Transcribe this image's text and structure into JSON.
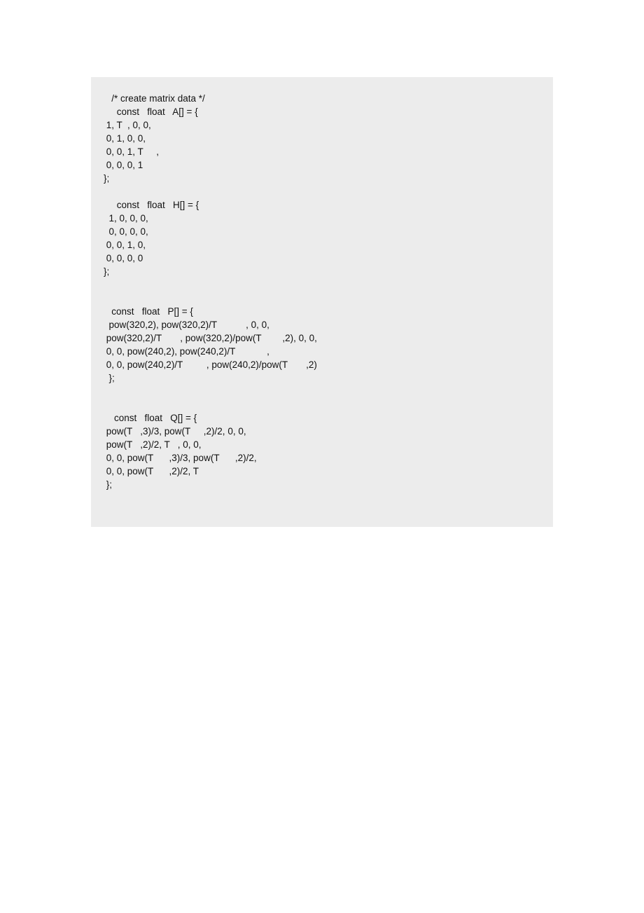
{
  "code": {
    "lines": [
      "   /* create matrix data */",
      "     const   float   A[] = {",
      " 1, T  , 0, 0,",
      " 0, 1, 0, 0,",
      " 0, 0, 1, T     ,",
      " 0, 0, 0, 1",
      "};",
      "",
      "     const   float   H[] = {",
      "  1, 0, 0, 0,",
      "  0, 0, 0, 0,",
      " 0, 0, 1, 0,",
      " 0, 0, 0, 0",
      "};",
      "",
      "",
      "   const   float   P[] = {",
      "  pow(320,2), pow(320,2)/T           , 0, 0,",
      " pow(320,2)/T       , pow(320,2)/pow(T        ,2), 0, 0,",
      " 0, 0, pow(240,2), pow(240,2)/T            ,",
      " 0, 0, pow(240,2)/T         , pow(240,2)/pow(T       ,2)",
      "  };",
      "",
      "",
      "    const   float   Q[] = {",
      " pow(T   ,3)/3, pow(T     ,2)/2, 0, 0,",
      " pow(T   ,2)/2, T   , 0, 0,",
      " 0, 0, pow(T      ,3)/3, pow(T      ,2)/2,",
      " 0, 0, pow(T      ,2)/2, T",
      " };"
    ]
  }
}
